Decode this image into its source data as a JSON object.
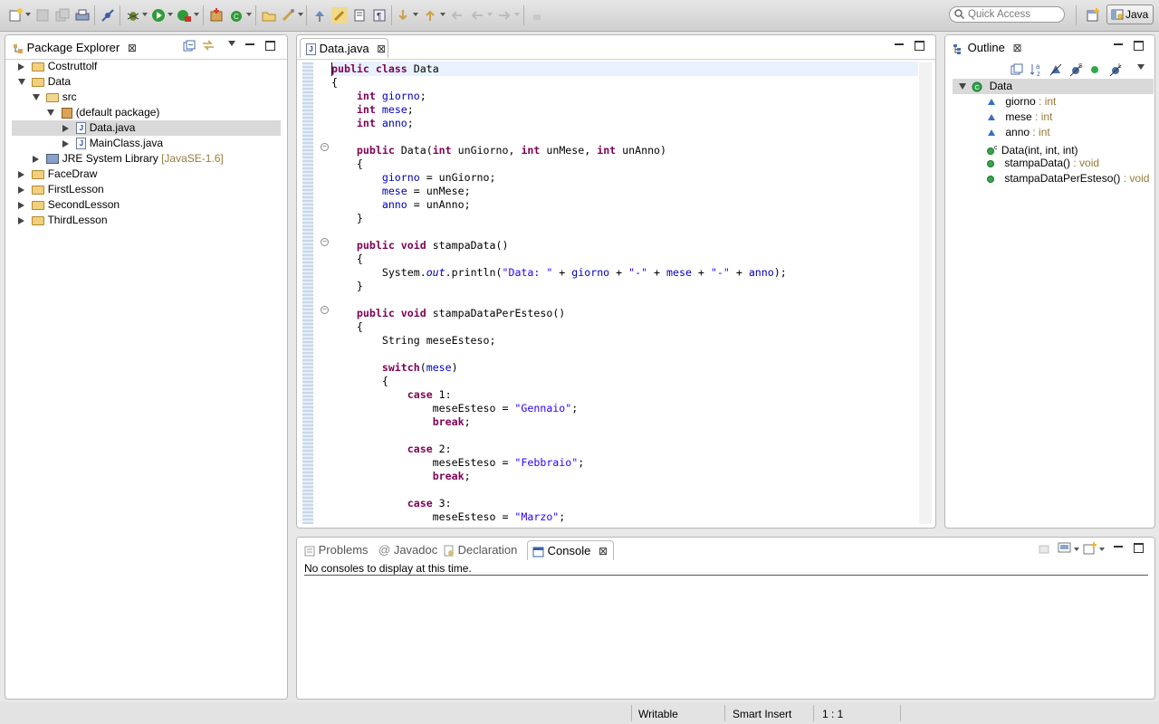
{
  "toolbar": {
    "quick_access_placeholder": "Quick Access",
    "perspective_label": "Java"
  },
  "package_explorer": {
    "title": "Package Explorer",
    "items": [
      {
        "label": "Costruttolf"
      },
      {
        "label": "Data"
      },
      {
        "label": "src"
      },
      {
        "label": "(default package)"
      },
      {
        "label": "Data.java"
      },
      {
        "label": "MainClass.java"
      },
      {
        "label": "JRE System Library",
        "version": "[JavaSE-1.6]"
      },
      {
        "label": "FaceDraw"
      },
      {
        "label": "FirstLesson"
      },
      {
        "label": "SecondLesson"
      },
      {
        "label": "ThirdLesson"
      }
    ]
  },
  "editor": {
    "tab_label": "Data.java"
  },
  "outline": {
    "title": "Outline",
    "root": "Data",
    "members": [
      {
        "name": "giorno",
        "type": " : int"
      },
      {
        "name": "mese",
        "type": " : int"
      },
      {
        "name": "anno",
        "type": " : int"
      },
      {
        "name": "Data(int, int, int)",
        "type": ""
      },
      {
        "name": "stampaData()",
        "type": " : void"
      },
      {
        "name": "stampaDataPerEsteso()",
        "type": " : void"
      }
    ]
  },
  "bottom_panel": {
    "tabs": [
      {
        "label": "Problems"
      },
      {
        "label": "Javadoc"
      },
      {
        "label": "Declaration"
      },
      {
        "label": "Console"
      }
    ],
    "console_message": "No consoles to display at this time."
  },
  "status_bar": {
    "writable": "Writable",
    "insert_mode": "Smart Insert",
    "cursor_position": "1 : 1"
  }
}
